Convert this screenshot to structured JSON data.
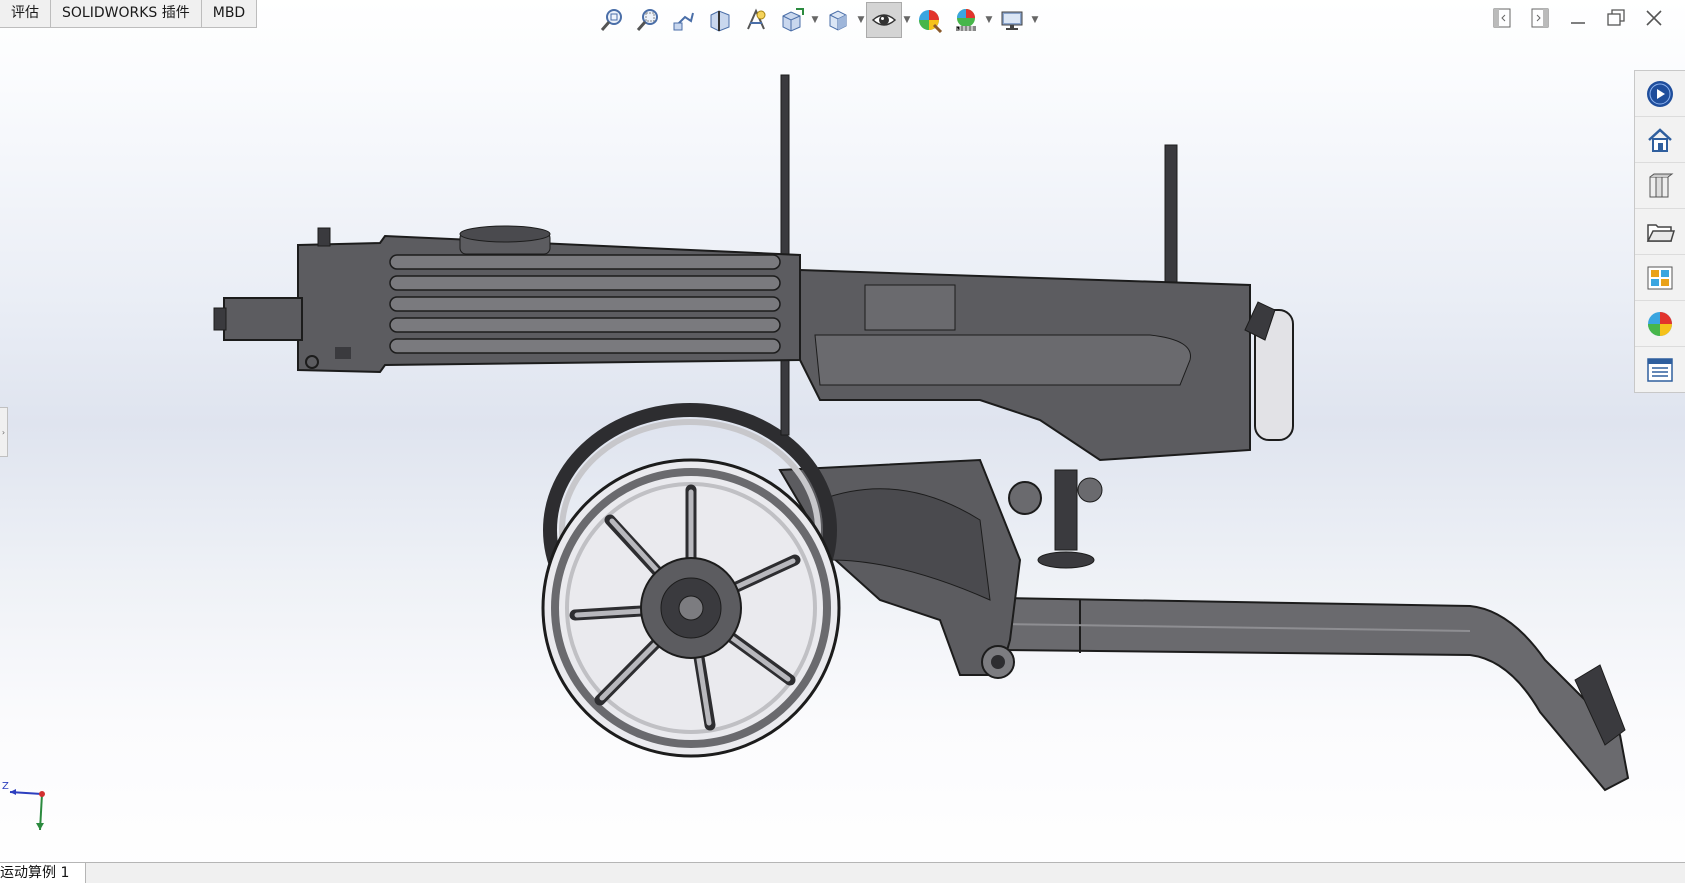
{
  "command_manager": {
    "tabs": [
      "评估",
      "SOLIDWORKS 插件",
      "MBD"
    ]
  },
  "heads_up_toolbar": {
    "buttons": [
      {
        "icon": "zoom-to-fit-icon"
      },
      {
        "icon": "zoom-to-area-icon"
      },
      {
        "icon": "previous-view-icon"
      },
      {
        "icon": "section-view-icon"
      },
      {
        "icon": "dynamic-annotation-views-icon"
      },
      {
        "icon": "view-orientation-icon",
        "dropdown": true
      },
      {
        "icon": "display-style-icon",
        "dropdown": true
      },
      {
        "icon": "hide-show-items-icon",
        "dropdown": true,
        "active": true
      },
      {
        "icon": "edit-appearance-icon"
      },
      {
        "icon": "apply-scene-icon",
        "dropdown": true
      },
      {
        "icon": "view-settings-icon",
        "dropdown": true
      }
    ]
  },
  "window_controls": [
    "tile-left-icon",
    "tile-right-icon",
    "minimize-icon",
    "restore-icon",
    "close-icon"
  ],
  "task_pane": {
    "buttons": [
      "solidworks-resources-icon",
      "home-icon",
      "design-library-icon",
      "file-explorer-icon",
      "view-palette-icon",
      "appearances-scenes-icon",
      "custom-properties-icon"
    ]
  },
  "bottom_tabs": {
    "active": "运动算例 1"
  },
  "triad": {
    "axis_label": "Z"
  },
  "colors": {
    "model_body": "#5c5c60",
    "model_dark": "#3a3a3e",
    "model_light": "#b8b8bd",
    "background_mid": "#dfe4ef"
  }
}
